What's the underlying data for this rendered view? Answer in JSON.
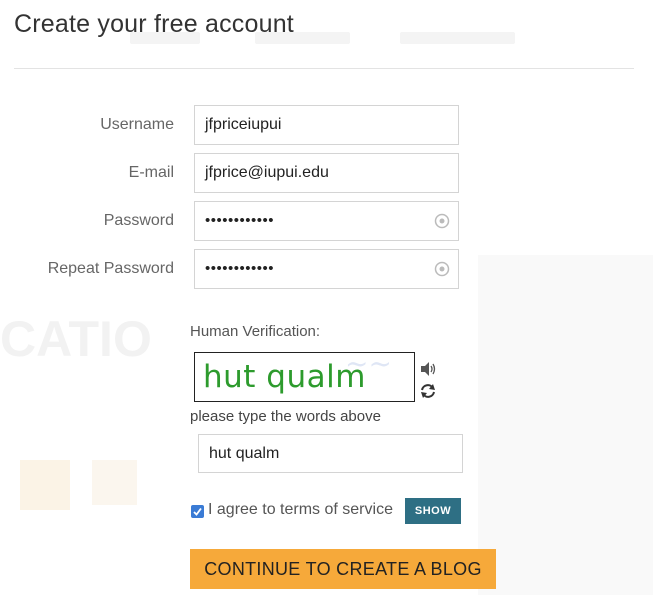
{
  "title": "Create your free account",
  "form": {
    "username": {
      "label": "Username",
      "value": "jfpriceiupui"
    },
    "email": {
      "label": "E-mail",
      "value": "jfprice@iupui.edu"
    },
    "password": {
      "label": "Password",
      "value": "••••••••••••"
    },
    "repeat_password": {
      "label": "Repeat Password",
      "value": "••••••••••••"
    }
  },
  "verification": {
    "label": "Human Verification:",
    "captcha_text": "hut qualm",
    "instruction": "please type the words above",
    "answer": "hut qualm"
  },
  "terms": {
    "label": "I agree to terms of service",
    "checked": true,
    "show_label": "SHOW"
  },
  "cta_label": "CONTINUE TO CREATE A BLOG",
  "colors": {
    "cta": "#f6a93a",
    "show_button": "#2e6f84",
    "captcha_text": "#2d9b2d",
    "checkbox": "#3a7bd5"
  },
  "icons": [
    "eye-icon",
    "audio-icon",
    "refresh-icon",
    "checkmark-icon"
  ]
}
